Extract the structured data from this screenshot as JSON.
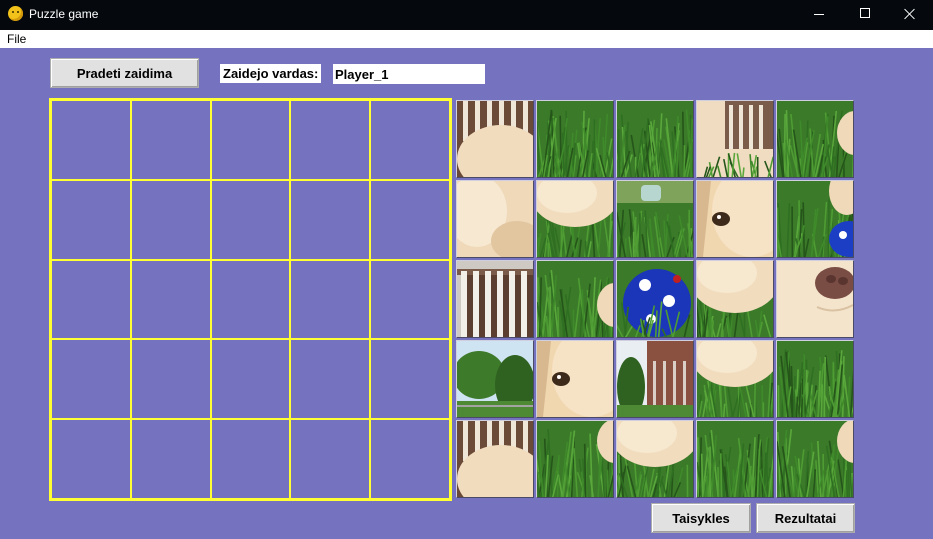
{
  "window": {
    "title": "Puzzle game",
    "icon": "face-emoji-icon"
  },
  "menu": {
    "file": "File"
  },
  "controls": {
    "start_label": "Pradeti zaidima",
    "player_name_label": "Zaidejo vardas:",
    "player_name_value": "Player_1",
    "rules_label": "Taisykles",
    "results_label": "Rezultatai"
  },
  "board": {
    "rows": 5,
    "cols": 5,
    "grid_color": "#ffff33",
    "background_color": "#7573bf"
  },
  "pieces": [
    [
      "fence-fur",
      "grass",
      "grass",
      "fur-fence",
      "grass-fur"
    ],
    [
      "fur",
      "fur-grass",
      "grass-toy",
      "puppy-eye",
      "grass-ball"
    ],
    [
      "fence",
      "grass-fur",
      "ball",
      "fur-grass",
      "puppy-nose"
    ],
    [
      "trees",
      "puppy-eye",
      "trees-house",
      "fur-grass",
      "grass"
    ],
    [
      "fence-fur",
      "grass-fur",
      "fur-grass",
      "grass",
      "grass-fur"
    ]
  ]
}
